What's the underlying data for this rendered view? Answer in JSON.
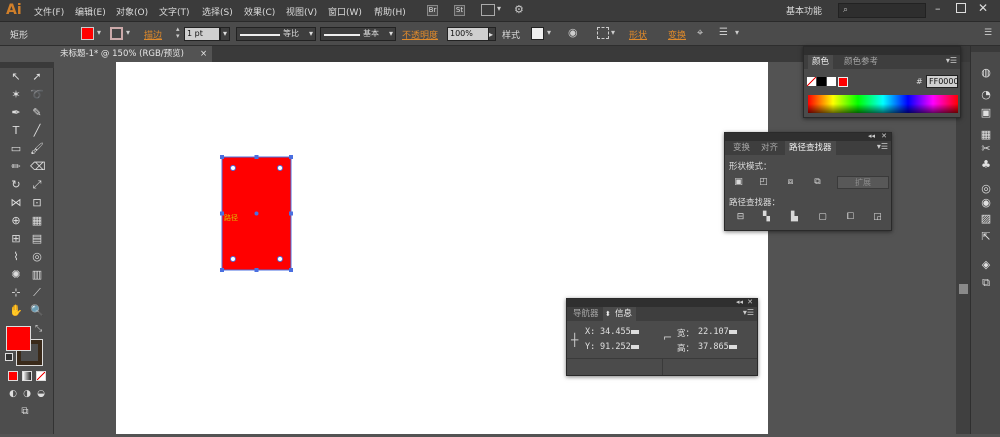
{
  "app": {
    "logo": "Ai",
    "menu": [
      "文件(F)",
      "编辑(E)",
      "对象(O)",
      "文字(T)",
      "选择(S)",
      "效果(C)",
      "视图(V)",
      "窗口(W)",
      "帮助(H)"
    ],
    "bridge_label": "Br",
    "stock_label": "St",
    "workspace": "基本功能"
  },
  "control_bar": {
    "object_type": "矩形",
    "fill_color": "#ff0000",
    "stroke_label": "描边",
    "stroke_weight": "1 pt",
    "profile_label": "等比",
    "brush_label": "基本",
    "opacity_label": "不透明度",
    "opacity_value": "100%",
    "style_label": "样式",
    "shape_label": "形状",
    "transform_label": "变换"
  },
  "document": {
    "tab_title": "未标题-1* @ 150% (RGB/预览)",
    "tab_close": "×",
    "object_label": "路径",
    "rect_color": "#ff0000",
    "selection_color": "#4a6fe0"
  },
  "toolbox": {
    "fill_color": "#ff0000",
    "stroke_color": "#3a2a1a"
  },
  "color_panel": {
    "tabs": [
      "颜色",
      "颜色参考"
    ],
    "hex_label": "#",
    "hex_value": "FF0000"
  },
  "pathfinder_panel": {
    "tabs": [
      "变换",
      "对齐",
      "路径查找器"
    ],
    "shape_modes_label": "形状模式：",
    "expand_label": "扩展",
    "pathfinders_label": "路径查找器："
  },
  "info_panel": {
    "tabs": [
      "导航器",
      "信息"
    ],
    "x_label": "X:",
    "x_value": "34.455",
    "y_label": "Y:",
    "y_value": "91.252",
    "w_label": "宽：",
    "w_value": "22.107",
    "h_label": "高：",
    "h_value": "37.865"
  }
}
